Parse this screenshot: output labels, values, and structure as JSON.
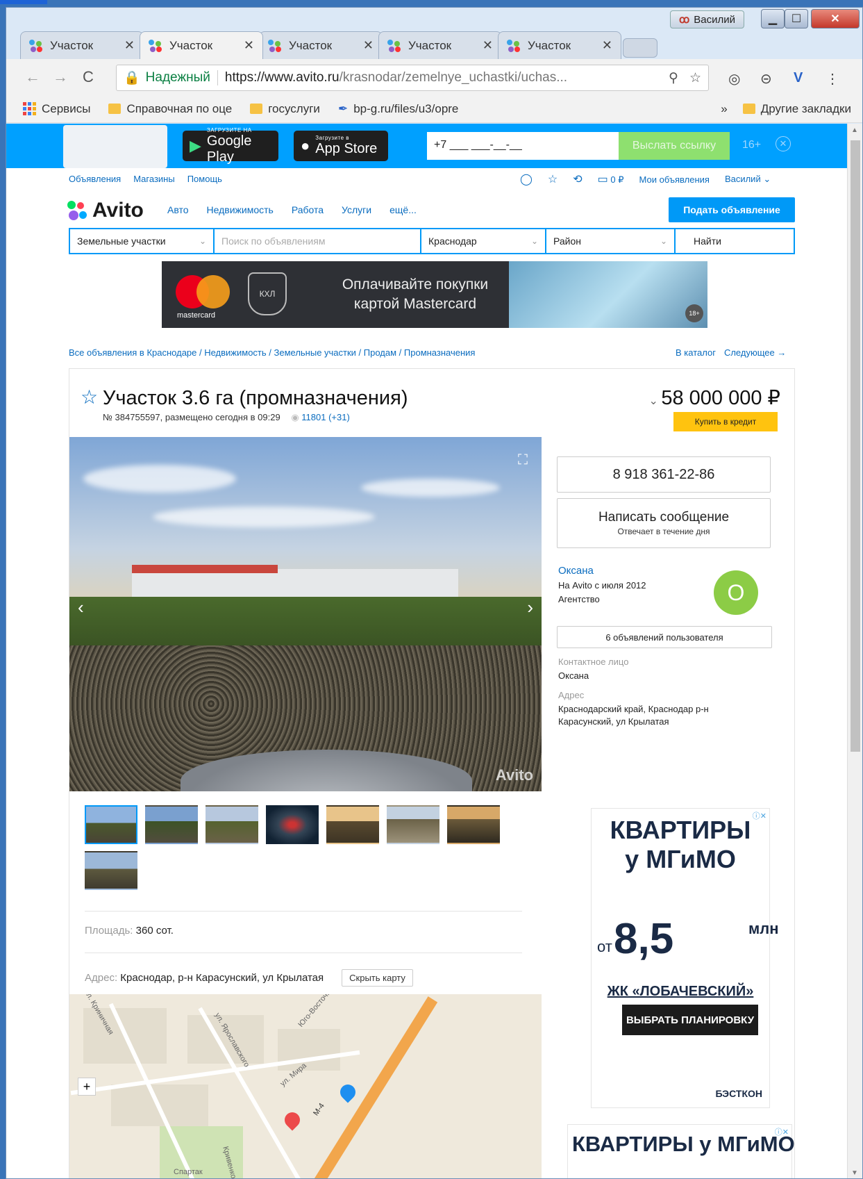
{
  "window": {
    "user": "Василий",
    "min_icon": "minimize-icon",
    "max_icon": "maximize-icon",
    "close_icon": "close-icon"
  },
  "tabs": [
    {
      "label": "Участок",
      "active": false
    },
    {
      "label": "Участок",
      "active": true
    },
    {
      "label": "Участок",
      "active": false
    },
    {
      "label": "Участок",
      "active": false
    },
    {
      "label": "Участок",
      "active": false
    }
  ],
  "toolbar": {
    "secure_label": "Надежный",
    "url_host": "https://www.avito.ru",
    "url_path": "/krasnodar/zemelnye_uchastki/uchas..."
  },
  "bookmarks": {
    "items": [
      "Сервисы",
      "Справочная по оце",
      "госуслуги",
      "bp-g.ru/files/u3/opre"
    ],
    "more": "»",
    "other": "Другие закладки"
  },
  "app_banner": {
    "google_small": "ЗАГРУЗИТЕ НА",
    "google_big": "Google Play",
    "apple_small": "Загрузите в",
    "apple_big": "App Store",
    "phone_value": "+7 ___ ___-__-__",
    "send_label": "Выслать ссылку",
    "age": "16+"
  },
  "toplinks": {
    "left": [
      "Объявления",
      "Магазины",
      "Помощь"
    ],
    "wallet": "0 ₽",
    "my_ads": "Мои объявления",
    "user": "Василий ⌄"
  },
  "header": {
    "logo": "Avito",
    "nav": [
      "Авто",
      "Недвижимость",
      "Работа",
      "Услуги",
      "ещё..."
    ],
    "post_label": "Подать объявление"
  },
  "search": {
    "category": "Земельные участки",
    "placeholder": "Поиск по объявлениям",
    "city": "Краснодар",
    "district": "Район",
    "find_label": "Найти"
  },
  "mc_banner": {
    "brand": "mastercard",
    "khl": "КХЛ",
    "text_line1": "Оплачивайте покупки",
    "text_line2": "картой Mastercard",
    "age": "18+"
  },
  "breadcrumb": {
    "path": "Все объявления в Краснодаре / Недвижимость / Земельные участки / Продам / Промназначения",
    "catalog": "В каталог",
    "next": "Следующее →"
  },
  "item": {
    "title": "Участок 3.6 га (промназначения)",
    "meta": "№ 384755597, размещено сегодня в 09:29",
    "views": "11801 (+31)",
    "price": "58 000 000 ₽",
    "credit_label": "Купить в кредит",
    "watermark": "Avito",
    "area_label": "Площадь:",
    "area_value": "360 сот.",
    "address_label": "Адрес:",
    "address_value": "Краснодар, р-н Карасунский, ул Крылатая",
    "hide_map": "Скрыть карту"
  },
  "seller": {
    "phone": "8 918 361-22-86",
    "message_label": "Написать сообщение",
    "message_sub": "Отвечает в течение дня",
    "name": "Оксана",
    "since": "На Avito с июля 2012",
    "type": "Агентство",
    "avatar_letter": "О",
    "ads_label": "6 объявлений пользователя",
    "contact_label": "Контактное лицо",
    "contact_value": "Оксана",
    "address_label": "Адрес",
    "address_line1": "Краснодарский край, Краснодар р-н",
    "address_line2": "Карасунский, ул Крылатая"
  },
  "map": {
    "labels": [
      "ул. Ярославского",
      "Юго-Восточная",
      "ул. Мира",
      "М-4",
      "Спартак",
      "Кривенковская",
      "ул. Криничная"
    ]
  },
  "ad1": {
    "line1": "КВАРТИРЫ",
    "line2": "у МГиМО",
    "from": "от",
    "price": "8,5",
    "unit": "млн",
    "jk": "ЖК «ЛОБАЧЕВСКИЙ»",
    "cta": "ВЫБРАТЬ ПЛАНИРОВКУ",
    "brand": "БЭСТКОН"
  },
  "ad2": {
    "line1": "КВАРТИРЫ у МГиМО"
  },
  "colors": {
    "avito_blue": "#0099f7",
    "link": "#0a6cbf",
    "credit": "#ffc30f",
    "avatar": "#8ccc46"
  }
}
